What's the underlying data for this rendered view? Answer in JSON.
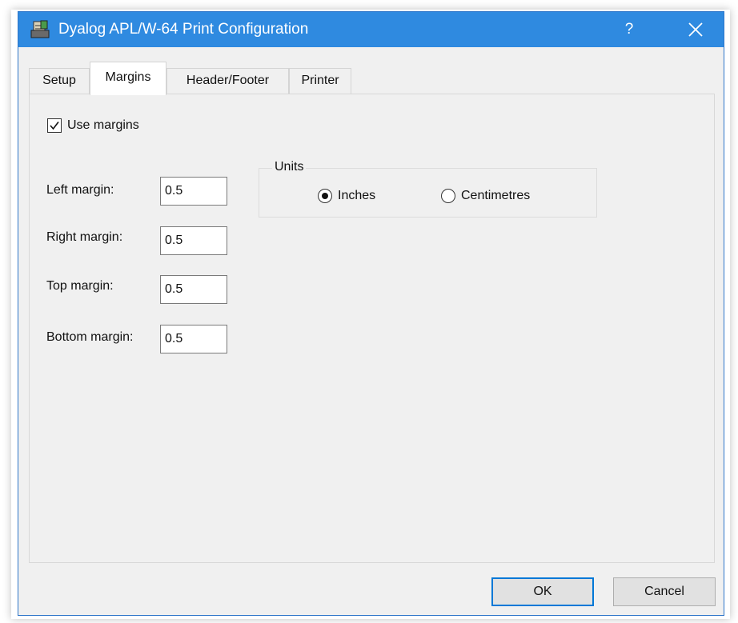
{
  "window": {
    "title": "Dyalog APL/W-64 Print Configuration",
    "help_label": "?",
    "title_color": "#2f8ae0",
    "icons": {
      "app": "apl-app-icon",
      "close": "close-icon"
    }
  },
  "tabs": [
    {
      "label": "Setup",
      "active": false
    },
    {
      "label": "Margins",
      "active": true
    },
    {
      "label": "Header/Footer",
      "active": false
    },
    {
      "label": "Printer",
      "active": false
    }
  ],
  "margins": {
    "use_margins": {
      "label": "Use margins",
      "checked": true
    },
    "left": {
      "label": "Left margin:",
      "value": "0.5"
    },
    "right": {
      "label": "Right margin:",
      "value": "0.5"
    },
    "top": {
      "label": "Top margin:",
      "value": "0.5"
    },
    "bottom": {
      "label": "Bottom margin:",
      "value": "0.5"
    }
  },
  "units": {
    "legend": "Units",
    "options": [
      {
        "label": "Inches",
        "selected": true
      },
      {
        "label": "Centimetres",
        "selected": false
      }
    ]
  },
  "buttons": {
    "ok": "OK",
    "cancel": "Cancel"
  }
}
